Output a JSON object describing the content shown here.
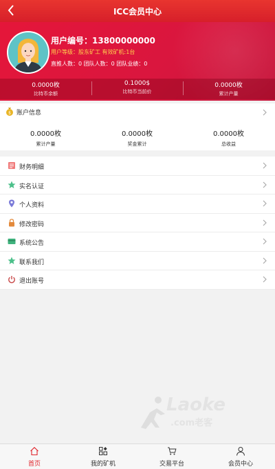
{
  "nav": {
    "title": "ICC会员中心",
    "back_icon": "chevron-left-icon"
  },
  "profile": {
    "user_id_label": "用户编号：13800000000",
    "level_text": "用户等级：股东矿工  有效矿机:1台",
    "counts_text": "直推人数：0 团队人数：0 团队业绩：0",
    "avatar_icon": "user-avatar-icon"
  },
  "stats": [
    {
      "value": "0.0000枚",
      "label": "比特币余额"
    },
    {
      "value": "0.1000$",
      "label": "比特币当前价"
    },
    {
      "value": "0.0000枚",
      "label": "累计产量"
    }
  ],
  "account": {
    "title": "账户信息",
    "icon": "money-bag-icon",
    "items": [
      {
        "value": "0.0000枚",
        "label": "累计产量"
      },
      {
        "value": "0.0000枚",
        "label": "奖金累计"
      },
      {
        "value": "0.0000枚",
        "label": "总收益"
      }
    ]
  },
  "menu": [
    {
      "label": "财务明细",
      "icon": "ledger-icon"
    },
    {
      "label": "实名认证",
      "icon": "star-icon"
    },
    {
      "label": "个人资料",
      "icon": "location-pin-icon"
    },
    {
      "label": "修改密码",
      "icon": "lock-icon"
    },
    {
      "label": "系统公告",
      "icon": "card-icon"
    },
    {
      "label": "联系我们",
      "icon": "star-icon"
    },
    {
      "label": "退出账号",
      "icon": "power-icon"
    }
  ],
  "watermark": {
    "brand": "Laoke",
    "sub": ".com老客"
  },
  "tabs": [
    {
      "label": "首页",
      "icon": "home-icon",
      "active": true
    },
    {
      "label": "我的矿机",
      "icon": "grid-icon",
      "active": false
    },
    {
      "label": "交易平台",
      "icon": "cart-icon",
      "active": false
    },
    {
      "label": "会员中心",
      "icon": "person-icon",
      "active": false
    }
  ],
  "colors": {
    "primary": "#e0252c",
    "header": "#dc1a3c",
    "level_text": "#ffd34d"
  }
}
